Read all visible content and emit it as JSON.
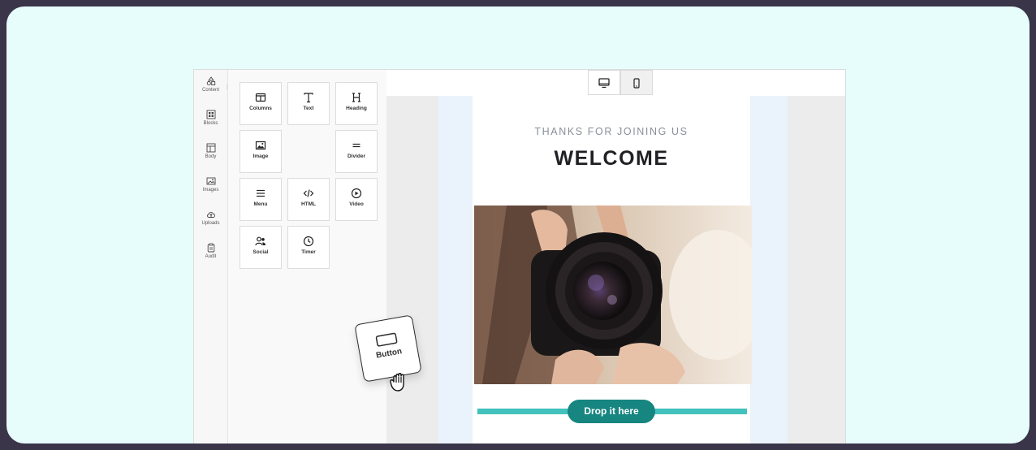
{
  "sidebar": {
    "items": [
      {
        "label": "Content",
        "icon": "shapes-icon"
      },
      {
        "label": "Blocks",
        "icon": "blocks-icon"
      },
      {
        "label": "Body",
        "icon": "layout-icon"
      },
      {
        "label": "Images",
        "icon": "image-icon"
      },
      {
        "label": "Uploads",
        "icon": "cloud-upload-icon"
      },
      {
        "label": "Audit",
        "icon": "clipboard-icon"
      }
    ]
  },
  "tools": [
    {
      "label": "Columns",
      "icon": "columns-icon"
    },
    {
      "label": "Text",
      "icon": "text-icon"
    },
    {
      "label": "Heading",
      "icon": "heading-icon"
    },
    {
      "label": "Image",
      "icon": "image-icon"
    },
    {
      "label": "Divider",
      "icon": "divider-icon"
    },
    {
      "label": "Menu",
      "icon": "menu-icon"
    },
    {
      "label": "HTML",
      "icon": "code-icon"
    },
    {
      "label": "Video",
      "icon": "play-icon"
    },
    {
      "label": "Social",
      "icon": "users-icon"
    },
    {
      "label": "Timer",
      "icon": "clock-icon"
    }
  ],
  "devices": {
    "desktop": "desktop-icon",
    "mobile": "mobile-icon",
    "active": "mobile"
  },
  "email": {
    "kicker": "THANKS FOR JOINING US",
    "headline": "WELCOME",
    "drop_label": "Drop it here"
  },
  "dragging": {
    "label": "Button",
    "icon": "button-icon"
  },
  "colors": {
    "frame_bg": "#e6fdfb",
    "outer_bg": "#3a3548",
    "accent": "#178580",
    "drop_line": "#43c2bd"
  }
}
